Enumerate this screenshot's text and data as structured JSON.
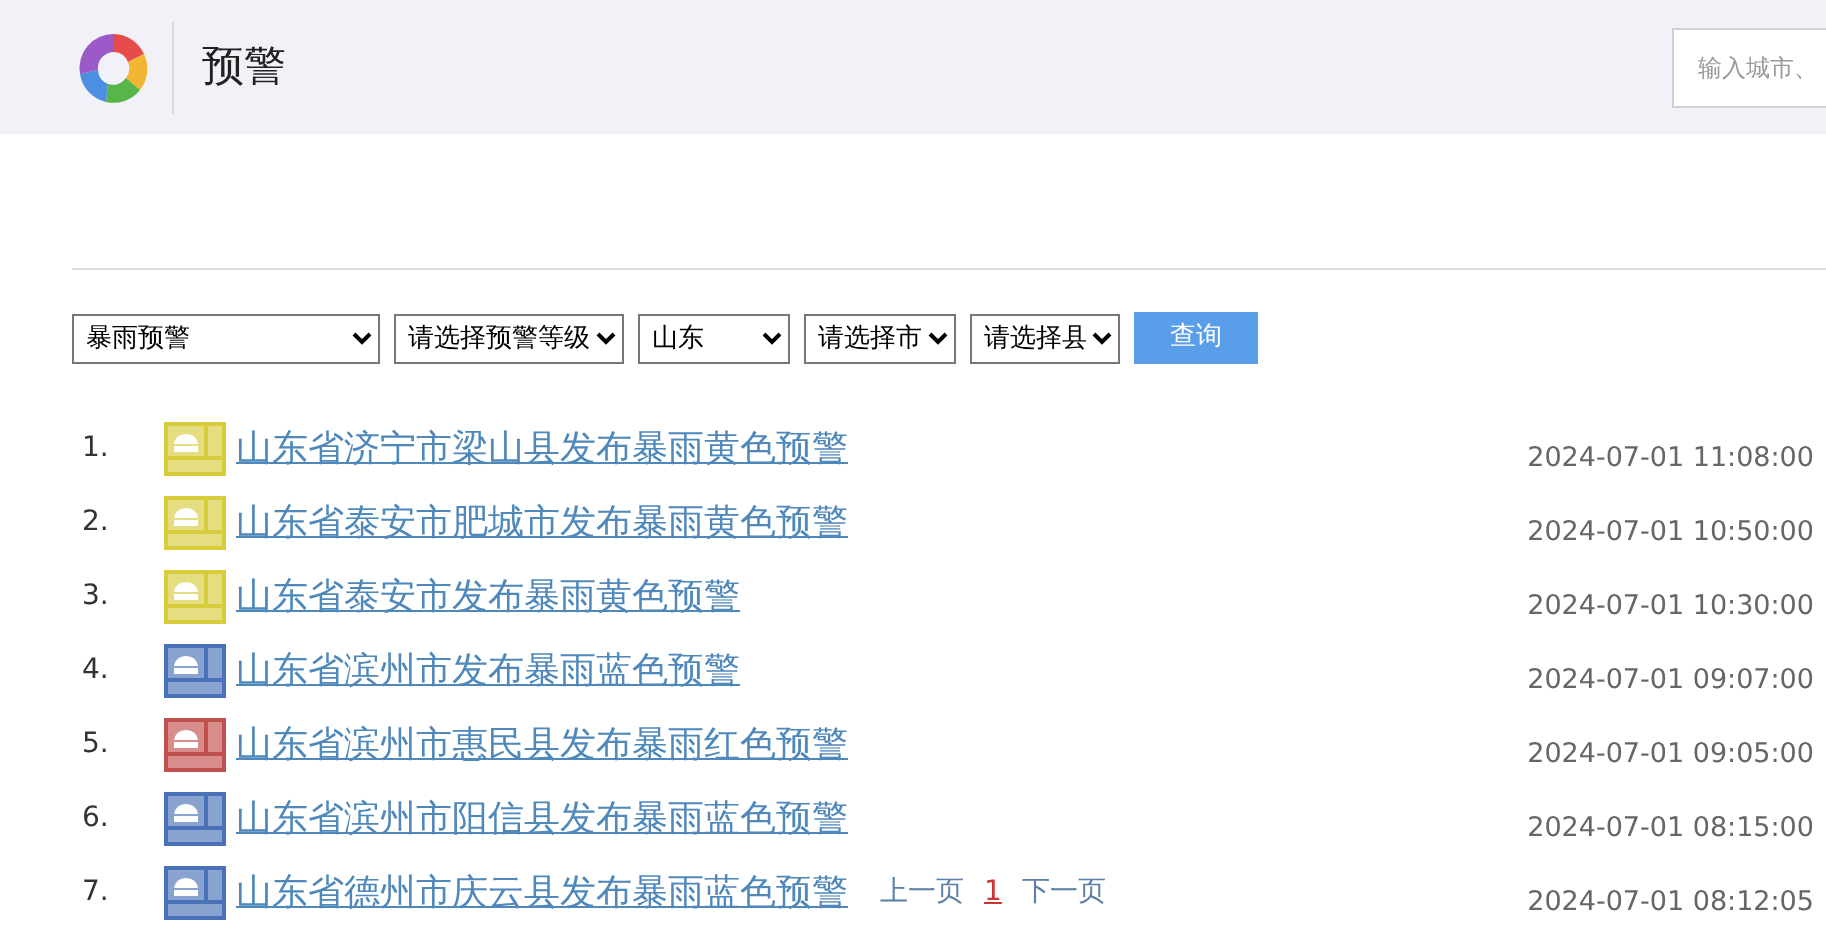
{
  "header": {
    "title": "预警",
    "search": {
      "placeholder": "输入城市、"
    }
  },
  "filters": [
    {
      "value": "暴雨预警"
    },
    {
      "value": "请选择预警等级"
    },
    {
      "value": "山东"
    },
    {
      "value": "请选择市"
    },
    {
      "value": "请选择县"
    }
  ],
  "query_button": "查询",
  "alerts": [
    {
      "number": "1.",
      "title": "山东省济宁市梁山县发布暴雨黄色预警",
      "time": "2024-07-01 11:08:00",
      "color": "#d6cc3c"
    },
    {
      "number": "2.",
      "title": "山东省泰安市肥城市发布暴雨黄色预警",
      "time": "2024-07-01 10:50:00",
      "color": "#d6cc3c"
    },
    {
      "number": "3.",
      "title": "山东省泰安市发布暴雨黄色预警",
      "time": "2024-07-01 10:30:00",
      "color": "#d6cc3c"
    },
    {
      "number": "4.",
      "title": "山东省滨州市发布暴雨蓝色预警",
      "time": "2024-07-01 09:07:00",
      "color": "#4a72b8"
    },
    {
      "number": "5.",
      "title": "山东省滨州市惠民县发布暴雨红色预警",
      "time": "2024-07-01 09:05:00",
      "color": "#c0504d"
    },
    {
      "number": "6.",
      "title": "山东省滨州市阳信县发布暴雨蓝色预警",
      "time": "2024-07-01 08:15:00",
      "color": "#4a72b8"
    },
    {
      "number": "7.",
      "title": "山东省德州市庆云县发布暴雨蓝色预警",
      "time": "2024-07-01 08:12:05",
      "color": "#4a72b8"
    }
  ],
  "pager": [
    {
      "label": "上一页",
      "selected": false
    },
    {
      "label": "1",
      "selected": true
    },
    {
      "label": "下一页",
      "selected": false
    }
  ]
}
